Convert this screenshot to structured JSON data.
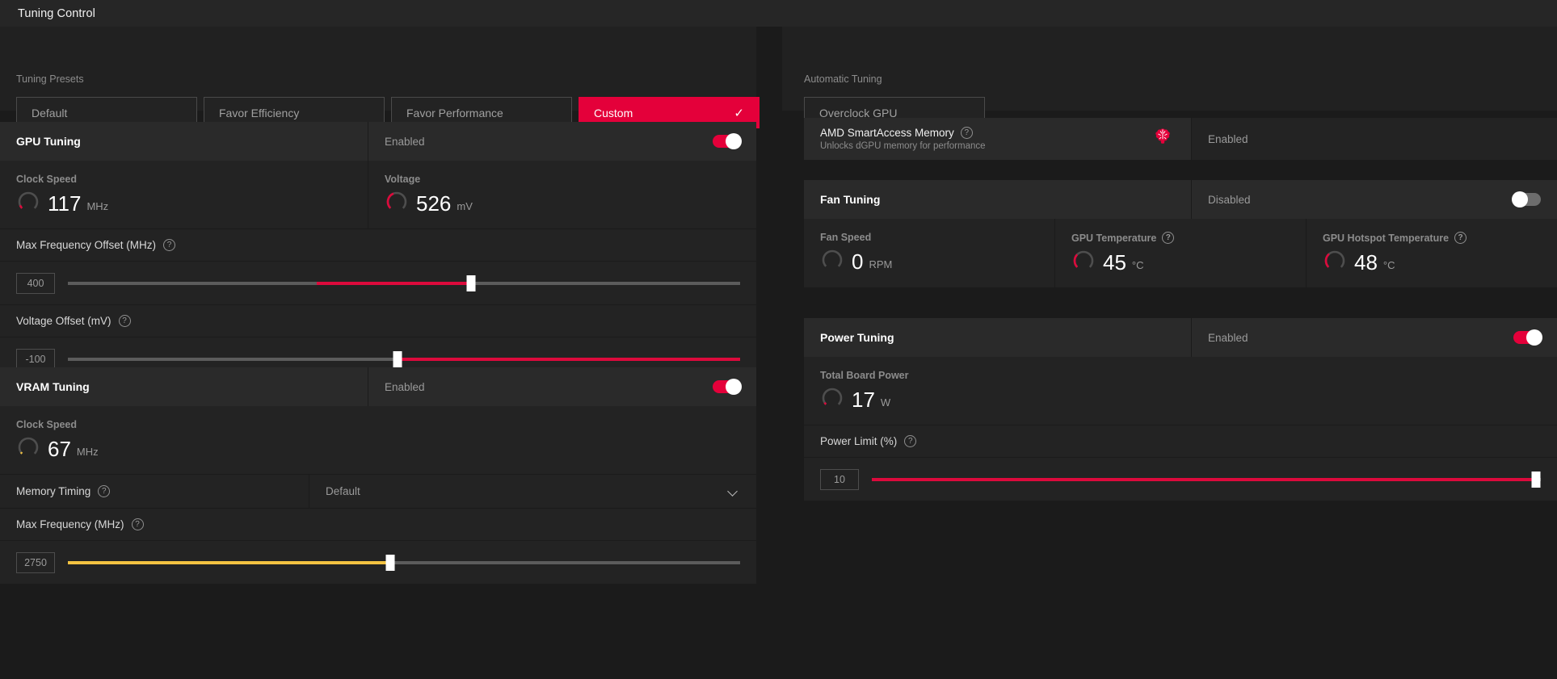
{
  "window": {
    "title": "Tuning Control"
  },
  "presets": {
    "label": "Tuning Presets",
    "items": [
      {
        "label": "Default",
        "active": false
      },
      {
        "label": "Favor Efficiency",
        "active": false
      },
      {
        "label": "Favor Performance",
        "active": false
      },
      {
        "label": "Custom",
        "active": true,
        "check": "✓"
      }
    ]
  },
  "automatic_tuning": {
    "label": "Automatic Tuning",
    "button": "Overclock GPU"
  },
  "gpu_tuning": {
    "title": "GPU Tuning",
    "status": "Enabled",
    "toggle_on": true,
    "metrics": [
      {
        "label": "Clock Speed",
        "value": "117",
        "unit": "MHz",
        "gauge_pct": 8,
        "gauge_color": "#dc0a3c"
      },
      {
        "label": "Voltage",
        "value": "526",
        "unit": "mV",
        "gauge_pct": 42,
        "gauge_color": "#dc0a3c"
      }
    ],
    "max_freq_offset": {
      "label": "Max Frequency Offset (MHz)",
      "help": "?",
      "value": "400",
      "fill_start_pct": 37,
      "thumb_pct": 60,
      "fill_color": "red"
    },
    "voltage_offset": {
      "label": "Voltage Offset (mV)",
      "help": "?",
      "value": "-100",
      "fill_start_pct": 49,
      "fill_end_pct": 100,
      "thumb_pct": 49,
      "fill_color": "red"
    }
  },
  "vram_tuning": {
    "title": "VRAM Tuning",
    "status": "Enabled",
    "toggle_on": true,
    "metrics": [
      {
        "label": "Clock Speed",
        "value": "67",
        "unit": "MHz",
        "gauge_pct": 4,
        "gauge_color": "#f3c342"
      }
    ],
    "memory_timing": {
      "label": "Memory Timing",
      "help": "?",
      "value": "Default"
    },
    "max_frequency": {
      "label": "Max Frequency (MHz)",
      "help": "?",
      "value": "2750",
      "fill_start_pct": 0,
      "thumb_pct": 48,
      "fill_color": "gold"
    }
  },
  "smart_access_memory": {
    "title": "AMD SmartAccess Memory",
    "help": "?",
    "subtitle": "Unlocks dGPU memory for performance",
    "icon": "brain-icon",
    "icon_color": "#e4003a",
    "status": "Enabled"
  },
  "fan_tuning": {
    "title": "Fan Tuning",
    "status": "Disabled",
    "toggle_on": false,
    "metrics": [
      {
        "label": "Fan Speed",
        "help": "",
        "value": "0",
        "unit": "RPM",
        "gauge_pct": 0,
        "gauge_color": "#5c5c5c"
      },
      {
        "label": "GPU Temperature",
        "help": "?",
        "value": "45",
        "unit": "°C",
        "gauge_pct": 33,
        "gauge_color": "#dc0a3c"
      },
      {
        "label": "GPU Hotspot Temperature",
        "help": "?",
        "value": "48",
        "unit": "°C",
        "gauge_pct": 35,
        "gauge_color": "#dc0a3c"
      }
    ]
  },
  "power_tuning": {
    "title": "Power Tuning",
    "status": "Enabled",
    "toggle_on": true,
    "metrics": [
      {
        "label": "Total Board Power",
        "value": "17",
        "unit": "W",
        "gauge_pct": 5,
        "gauge_color": "#dc0a3c"
      }
    ],
    "power_limit": {
      "label": "Power Limit (%)",
      "help": "?",
      "value": "10",
      "fill_start_pct": 0,
      "thumb_pct": 99.3,
      "fill_color": "red"
    }
  },
  "colors": {
    "accent_red": "#e4003a",
    "slider_red": "#dc0a3c",
    "slider_gold": "#f3c342",
    "bg": "#1b1b1b",
    "card": "#232323",
    "card_header": "#2a2a2a"
  }
}
